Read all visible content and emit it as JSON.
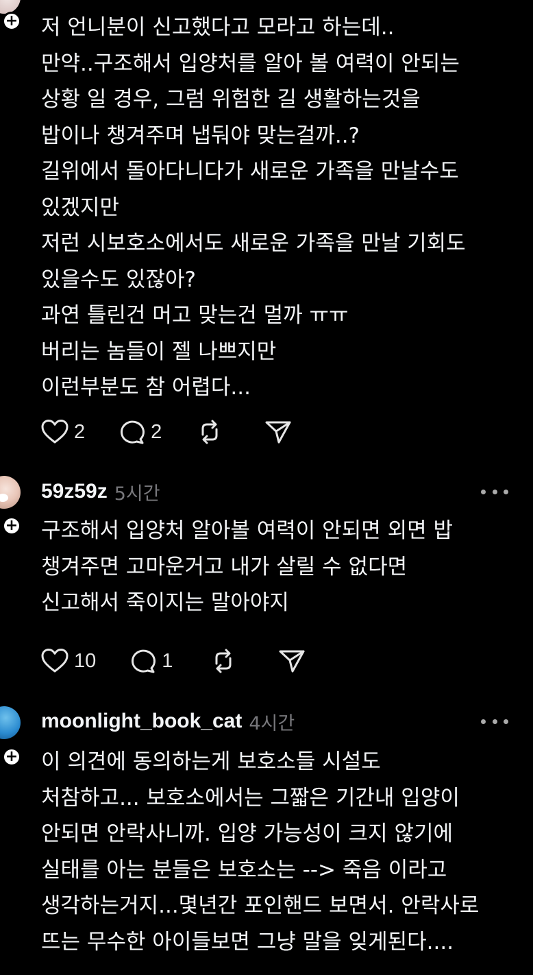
{
  "posts": [
    {
      "username": "",
      "time": "",
      "lines": [
        "저 언니분이 신고했다고 모라고 하는데..",
        "만약..구조해서 입양처를 알아 볼 여력이 안되는",
        "상황 일 경우, 그럼 위험한 길 생활하는것을",
        "밥이나 챙겨주며 냅둬야 맞는걸까..?",
        "길위에서 돌아다니다가 새로운 가족을 만날수도",
        "있겠지만",
        "저런 시보호소에서도 새로운 가족을 만날 기회도",
        "있을수도 있잖아?",
        "과연 틀린건 머고 맞는건 멀까 ㅠㅠ",
        "버리는 놈들이 젤 나쁘지만",
        "이런부분도 참 어렵다..."
      ],
      "likes": "2",
      "replies": "2"
    },
    {
      "username": "59z59z",
      "time": "5시간",
      "lines": [
        "구조해서 입양처 알아볼 여력이 안되면 외면 밥",
        "챙겨주면 고마운거고 내가 살릴 수 없다면",
        "신고해서 죽이지는 말아야지"
      ],
      "likes": "10",
      "replies": "1"
    },
    {
      "username": "moonlight_book_cat",
      "time": "4시간",
      "lines": [
        "이 의견에 동의하는게 보호소들 시설도",
        "처참하고... 보호소에서는 그짧은 기간내 입양이",
        "안되면 안락사니까. 입양 가능성이 크지 않기에",
        "실태를 아는 분들은 보호소는 --> 죽음 이라고",
        "생각하는거지...몇년간 포인핸드 보면서. 안락사로",
        "뜨는 무수한 아이들보면 그냥 말을 잊게된다...."
      ]
    }
  ],
  "icons": {
    "follow": "plus-icon",
    "like": "heart-icon",
    "reply": "comment-icon",
    "repost": "repost-icon",
    "share": "send-icon",
    "more": "more-dots-icon"
  },
  "colors": {
    "background": "#000000",
    "text": "#f3f5f7",
    "secondary": "#77777b",
    "icon": "#e6e6e6"
  }
}
